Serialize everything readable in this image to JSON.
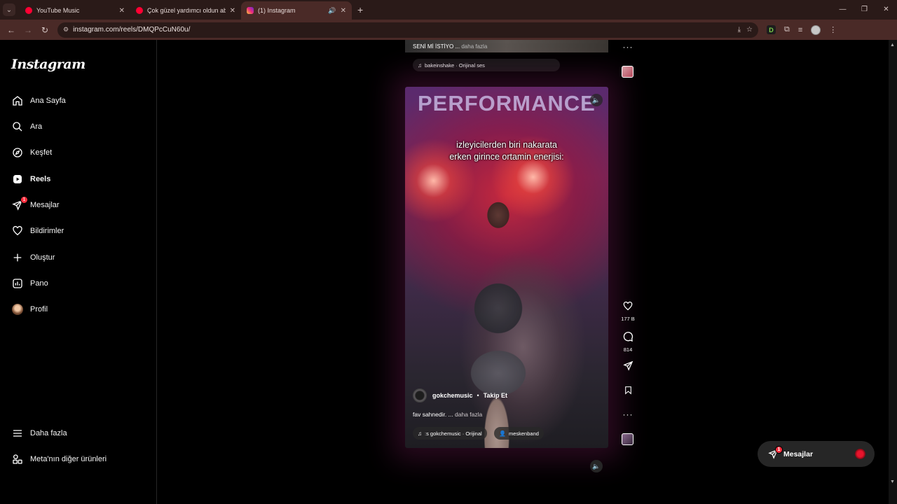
{
  "browser": {
    "tabs": [
      {
        "title": "YouTube Music",
        "color": "#ff0033",
        "active": false
      },
      {
        "title": "Çok güzel yardımcı oldun abi 🙂",
        "color": "#ff0033",
        "active": false
      },
      {
        "title": "(1) Instagram",
        "color": "#e1306c",
        "active": true
      }
    ],
    "url": "instagram.com/reels/DMQPcCuN60u/",
    "extension_letter": "D"
  },
  "sidebar": {
    "logo": "Instagram",
    "items": [
      {
        "label": "Ana Sayfa",
        "icon": "home-icon"
      },
      {
        "label": "Ara",
        "icon": "search-icon"
      },
      {
        "label": "Keşfet",
        "icon": "explore-icon"
      },
      {
        "label": "Reels",
        "icon": "reels-icon",
        "active": true
      },
      {
        "label": "Mesajlar",
        "icon": "messages-icon",
        "badge": "1"
      },
      {
        "label": "Bildirimler",
        "icon": "heart-icon"
      },
      {
        "label": "Oluştur",
        "icon": "plus-icon"
      },
      {
        "label": "Pano",
        "icon": "dashboard-icon"
      },
      {
        "label": "Profil",
        "icon": "profile-avatar"
      }
    ],
    "bottom": [
      {
        "label": "Daha fazla",
        "icon": "menu-icon"
      },
      {
        "label": "Meta'nın diğer ürünleri",
        "icon": "meta-products-icon"
      }
    ]
  },
  "previous_reel": {
    "caption": "SENİ Mİ İSTİYO ...",
    "more": "daha fazla",
    "audio": "bakeinshake · Orijinal ses"
  },
  "reel": {
    "overlay_banner": "PERFORMANCE",
    "subtitle_line1": "izleyicilerden biri nakarata",
    "subtitle_line2": "erken girince ortamin enerjisi:",
    "owner": "gokchemusic",
    "separator": "•",
    "follow_label": "Takip Et",
    "caption": "fav sahnedir. ...",
    "more": "daha fazla",
    "audio_chip": "ːs gokchemusic · Orijinal",
    "tag_chip": "meskenband",
    "likes": "177 B",
    "comments": "814"
  },
  "messages_bubble": {
    "label": "Mesajlar",
    "badge": "1"
  }
}
